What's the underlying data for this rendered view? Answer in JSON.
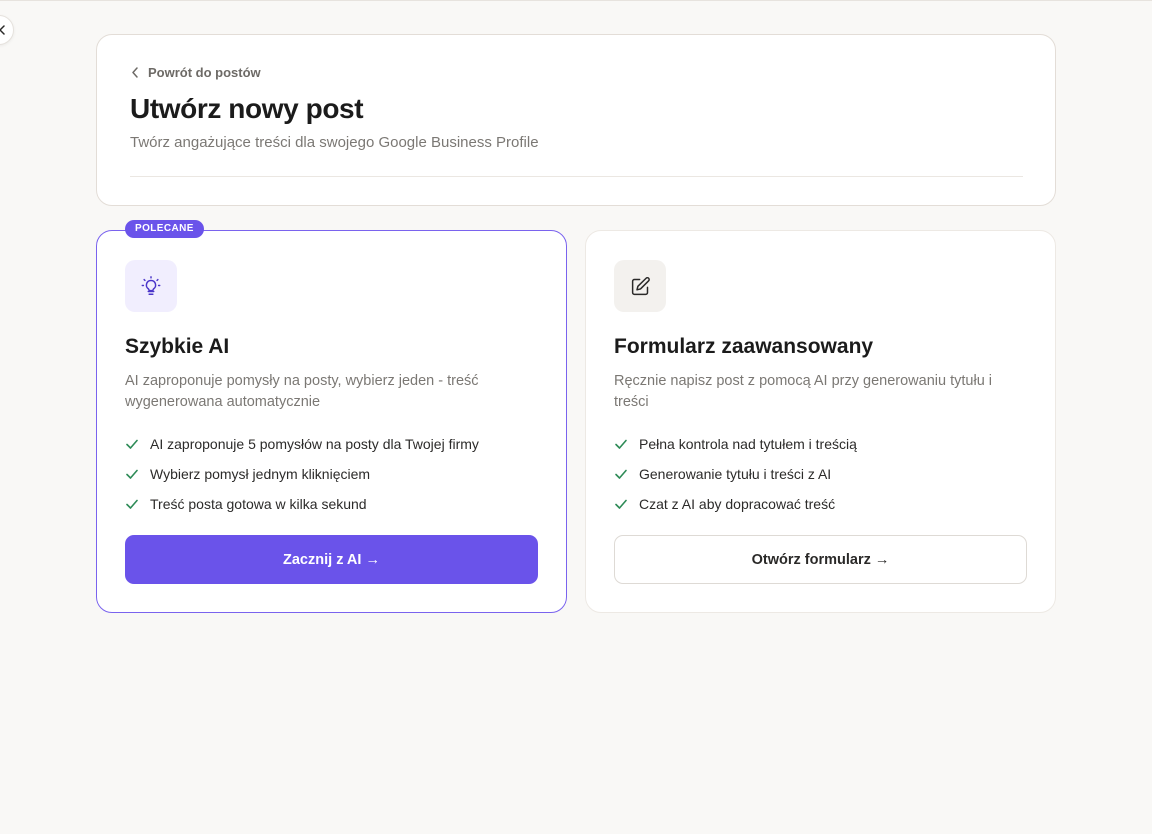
{
  "header": {
    "back_label": "Powrót do postów",
    "title": "Utwórz nowy post",
    "subtitle": "Twórz angażujące treści dla swojego Google Business Profile"
  },
  "options": {
    "quick_ai": {
      "badge": "POLECANE",
      "icon": "lightbulb-icon",
      "title": "Szybkie AI",
      "description": "AI zaproponuje pomysły na posty, wybierz jeden - treść wygenerowana automatycznie",
      "features": [
        "AI zaproponuje 5 pomysłów na posty dla Twojej firmy",
        "Wybierz pomysł jednym kliknięciem",
        "Treść posta gotowa w kilka sekund"
      ],
      "button_label": "Zacznij z AI →"
    },
    "advanced_form": {
      "icon": "edit-icon",
      "title": "Formularz zaawansowany",
      "description": "Ręcznie napisz post z pomocą AI przy generowaniu tytułu i treści",
      "features": [
        "Pełna kontrola nad tytułem i treścią",
        "Generowanie tytułu i treści z AI",
        "Czat z AI aby dopracować treść"
      ],
      "button_label": "Otwórz formularz →"
    }
  },
  "colors": {
    "accent": "#6a53ea",
    "check": "#2e8b57",
    "background": "#f9f8f6"
  }
}
